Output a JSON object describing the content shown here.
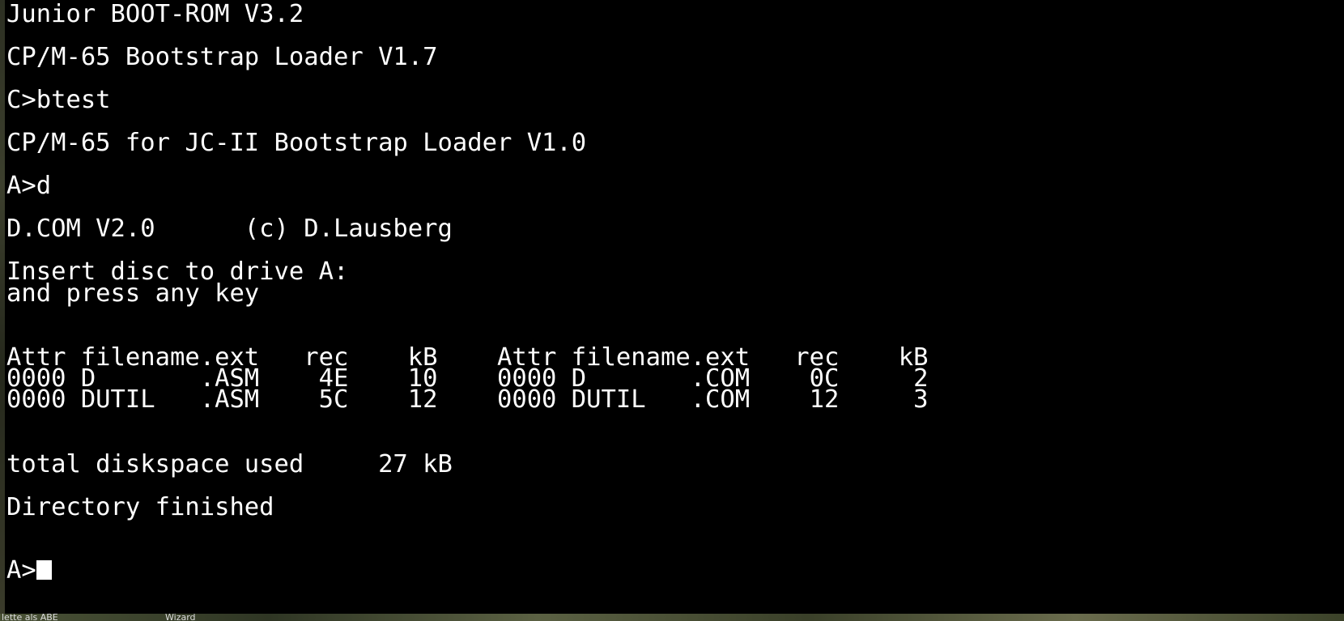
{
  "terminal": {
    "lines": [
      "Junior BOOT-ROM V3.2",
      "CP/M-65 Bootstrap Loader V1.7",
      "C>btest",
      "CP/M-65 for JC-II Bootstrap Loader V1.0",
      "A>d",
      "D.COM V2.0      (c) D.Lausberg",
      "Insert disc to drive A:",
      "and press any key",
      "Attr filename.ext   rec    kB    Attr filename.ext   rec    kB",
      "0000 D       .ASM    4E    10    0000 D       .COM    0C     2",
      "0000 DUTIL   .ASM    5C    12    0000 DUTIL   .COM    12     3",
      "total diskspace used     27 kB",
      "Directory finished"
    ],
    "prompt": "A>"
  },
  "desktop": {
    "label_left": "lette als ABE",
    "label_right": "Wizard"
  },
  "colors": {
    "background": "#000000",
    "foreground": "#ffffff"
  }
}
